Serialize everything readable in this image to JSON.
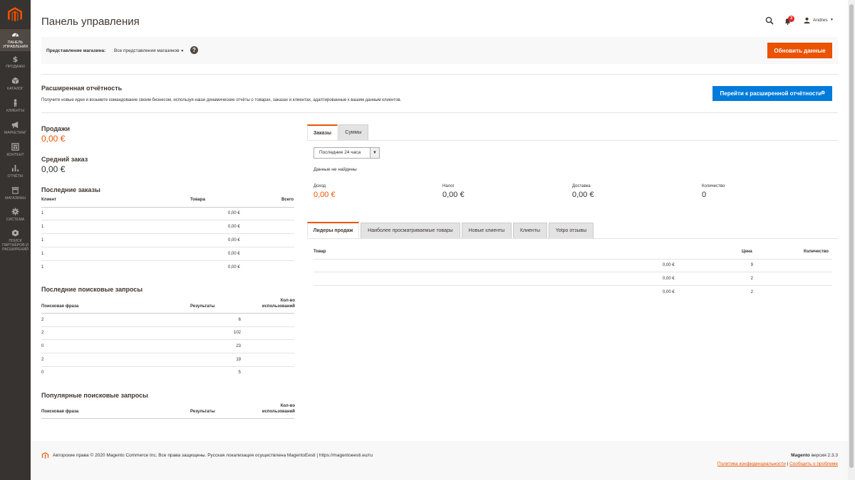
{
  "sidebar": {
    "items": [
      {
        "label": "ПАНЕЛЬ УПРАВЛЕНИЯ",
        "icon": "dashboard-icon",
        "active": true
      },
      {
        "label": "ПРОДАЖИ",
        "icon": "dollar-icon"
      },
      {
        "label": "КАТАЛОГ",
        "icon": "box-icon"
      },
      {
        "label": "КЛИЕНТЫ",
        "icon": "person-icon"
      },
      {
        "label": "МАРКЕТИНГ",
        "icon": "megaphone-icon"
      },
      {
        "label": "КОНТЕНТ",
        "icon": "layout-icon"
      },
      {
        "label": "ОТЧЁТЫ",
        "icon": "bar-chart-icon"
      },
      {
        "label": "МАГАЗИНЫ",
        "icon": "store-icon"
      },
      {
        "label": "СИСТЕМА",
        "icon": "gear-icon"
      },
      {
        "label": "ПОИСК ПАРТНЁРОВ И РАСШИРЕНИЙ",
        "icon": "puzzle-icon"
      }
    ]
  },
  "header": {
    "title": "Панель управления",
    "notifications_count": "3",
    "user": "Andres"
  },
  "store_bar": {
    "label": "Представление магазина:",
    "value": "Все представления магазинов",
    "help": "?",
    "refresh_label": "Обновить данные"
  },
  "advanced": {
    "title": "Расширенная отчётность",
    "description": "Получите новые идеи и возьмите командование своим бизнесом, используя наши динамические отчёты о товарах, заказах и клиентах, адаптированные к вашим данным клиентов.",
    "button": "Перейти к расширенной отчётности"
  },
  "sales": {
    "label": "Продажи",
    "value": "0,00 €"
  },
  "avg_order": {
    "label": "Средний заказ",
    "value": "0,00 €"
  },
  "last_orders": {
    "title": "Последние заказы",
    "headers": [
      "Клиент",
      "Товара",
      "Всего"
    ],
    "rows": [
      [
        "1",
        "",
        "0,00 €"
      ],
      [
        "1",
        "",
        "0,00 €"
      ],
      [
        "1",
        "",
        "0,00 €"
      ],
      [
        "1",
        "",
        "0,00 €"
      ],
      [
        "1",
        "",
        "0,00 €"
      ]
    ]
  },
  "last_search": {
    "title": "Последние поисковые запросы",
    "headers": [
      "Поисковая фраза",
      "Результаты",
      "Кол-во использований"
    ],
    "rows": [
      [
        "2",
        "6",
        ""
      ],
      [
        "2",
        "102",
        ""
      ],
      [
        "0",
        "23",
        ""
      ],
      [
        "2",
        "19",
        ""
      ],
      [
        "0",
        "5",
        ""
      ]
    ]
  },
  "popular_search": {
    "title": "Популярные поисковые запросы",
    "headers": [
      "Поисковая фраза",
      "Результаты",
      "Кол-во использований"
    ]
  },
  "chart_tabs": [
    "Заказы",
    "Суммы"
  ],
  "period": "Последние 24 часа",
  "no_data": "Данные не найдены",
  "totals": [
    {
      "label": "Доход",
      "value": "0,00 €"
    },
    {
      "label": "Налог",
      "value": "0,00 €"
    },
    {
      "label": "Доставка",
      "value": "0,00 €"
    },
    {
      "label": "Количество",
      "value": "0"
    }
  ],
  "grid_tabs": [
    "Лидеры продаж",
    "Наиболее просматриваемые товары",
    "Новые клиенты",
    "Клиенты",
    "Yotpo отзывы"
  ],
  "bestsellers": {
    "headers": [
      "Товар",
      "Цена",
      "Количество"
    ],
    "rows": [
      [
        "",
        "0,00 €",
        "9"
      ],
      [
        "",
        "0,00 €",
        "2"
      ],
      [
        "",
        "0,00 €",
        "2"
      ]
    ]
  },
  "footer": {
    "copyright": "Авторские права © 2020 Magento Commerce Inc. Все права защищены. Русская локализация осуществлена MagentoEesti | https://magentoeesti.eu/ru",
    "brand": "Magento",
    "version": " версия 2.3.3",
    "privacy": "Политика конфиденциальности",
    "sep": " | ",
    "report": "Сообщить о проблеме"
  },
  "colors": {
    "accent": "#eb5202",
    "link_button": "#007bdb",
    "sidebar": "#373330"
  }
}
